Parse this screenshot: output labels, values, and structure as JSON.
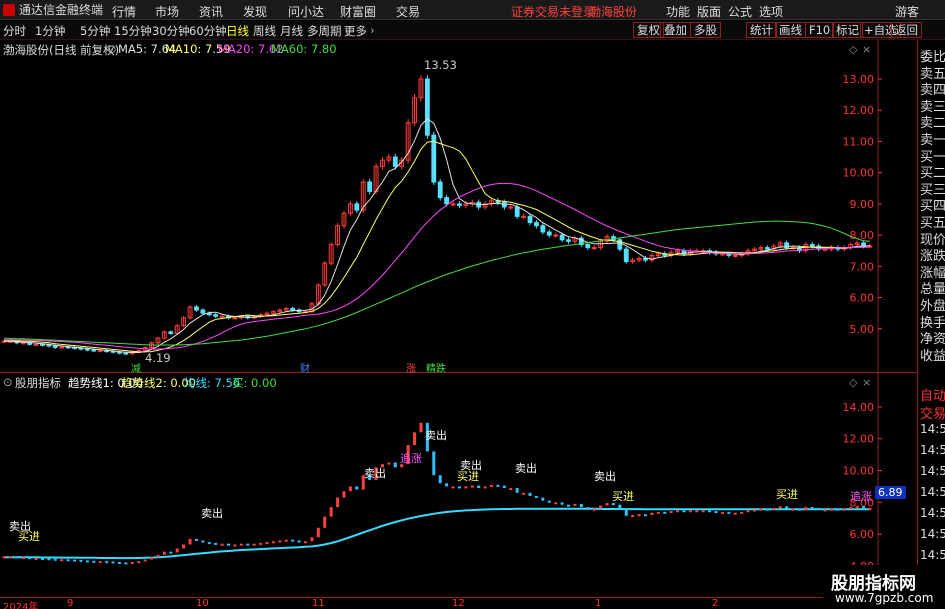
{
  "app": {
    "title": "通达信金融终端",
    "menus": [
      "行情",
      "市场",
      "资讯",
      "发现",
      "问小达",
      "财富圈",
      "交易"
    ],
    "login_notice": "证券交易未登录",
    "stock_link": "渤海股份",
    "right_menus": [
      "功能",
      "版面",
      "公式",
      "选项"
    ],
    "guest": "游客"
  },
  "period_tabs": [
    "分时",
    "1分钟",
    "5分钟",
    "15分钟",
    "30分钟",
    "60分钟",
    "日线",
    "周线",
    "月线",
    "多周期",
    "更多"
  ],
  "active_period": "日线",
  "right_tools": [
    "复权",
    "叠加",
    "多股",
    "统计",
    "画线",
    "F10",
    "标记",
    "+自选",
    "返回"
  ],
  "main_chart": {
    "stock_label": "渤海股份(日线 前复权)",
    "ma_legend": [
      {
        "label": "MA5: 7.64",
        "color": "#e0e0e0"
      },
      {
        "label": "MA10: 7.59",
        "color": "#ffff66"
      },
      {
        "label": "MA20: 7.62",
        "color": "#ff44ff"
      },
      {
        "label": "MA60: 7.80",
        "color": "#44dd44"
      }
    ],
    "high_label": "13.53",
    "low_label": "4.19",
    "markers": [
      {
        "text": "减",
        "color": "#44dd44"
      },
      {
        "text": "财",
        "color": "#4488ff"
      },
      {
        "text": "涨",
        "color": "#ff4444"
      },
      {
        "text": "精跌",
        "color": "#44dd44"
      }
    ]
  },
  "sub_chart": {
    "label": "股朋指标",
    "legend": [
      {
        "label": "趋势线1: 0.00",
        "color": "#ffffff"
      },
      {
        "label": "趋势线2: 0.00",
        "color": "#ffff66"
      },
      {
        "label": "均线: 7.56",
        "color": "#33ddff"
      },
      {
        "label": "买: 0.00",
        "color": "#44dd44"
      }
    ],
    "current_value": "6.89",
    "sell_label": "卖出",
    "buy_label": "买进",
    "up_label": "追涨"
  },
  "right_panel_items": [
    "委比",
    "卖五",
    "卖四",
    "卖三",
    "卖二",
    "卖一",
    "买一",
    "买二",
    "买三",
    "买四",
    "买五",
    "现价",
    "涨跌",
    "涨幅",
    "总量",
    "外盘",
    "换手",
    "净资",
    "收益"
  ],
  "right_panel_lower": [
    "自动",
    "交易"
  ],
  "right_panel_times": [
    "14:5",
    "14:5",
    "14:5",
    "14:5",
    "14:5",
    "14:5",
    "14:5",
    "14:5"
  ],
  "xaxis_labels": [
    "2024年",
    "9",
    "10",
    "11",
    "12",
    "1",
    "2"
  ],
  "watermark": {
    "title": "股朋指标网",
    "url": "www.7gpzb.com"
  },
  "chart_data": [
    {
      "type": "candlestick",
      "title": "渤海股份(日线 前复权)",
      "y_ticks": [
        5.0,
        6.0,
        7.0,
        8.0,
        9.0,
        10.0,
        11.0,
        12.0,
        13.0
      ],
      "ylim": [
        4.0,
        13.8
      ],
      "close": [
        4.6,
        4.6,
        4.55,
        4.55,
        4.5,
        4.5,
        4.48,
        4.45,
        4.4,
        4.42,
        4.4,
        4.38,
        4.35,
        4.32,
        4.3,
        4.3,
        4.28,
        4.25,
        4.22,
        4.2,
        4.25,
        4.3,
        4.4,
        4.55,
        4.7,
        4.9,
        4.85,
        5.1,
        5.35,
        5.7,
        5.6,
        5.5,
        5.45,
        5.4,
        5.4,
        5.35,
        5.35,
        5.4,
        5.35,
        5.4,
        5.45,
        5.5,
        5.55,
        5.6,
        5.65,
        5.6,
        5.55,
        5.55,
        5.8,
        6.4,
        7.1,
        7.7,
        8.3,
        8.7,
        9.0,
        8.8,
        9.7,
        9.4,
        10.2,
        10.4,
        10.5,
        10.2,
        10.4,
        11.6,
        12.4,
        13.0,
        11.2,
        9.7,
        9.2,
        9.0,
        9.0,
        8.95,
        9.0,
        9.05,
        8.9,
        9.0,
        9.1,
        9.05,
        8.9,
        8.9,
        8.6,
        8.6,
        8.4,
        8.3,
        8.1,
        8.0,
        8.0,
        7.85,
        7.8,
        7.9,
        7.7,
        7.6,
        7.6,
        7.8,
        7.95,
        7.85,
        7.55,
        7.15,
        7.2,
        7.25,
        7.2,
        7.35,
        7.4,
        7.35,
        7.45,
        7.5,
        7.4,
        7.5,
        7.5,
        7.5,
        7.45,
        7.4,
        7.4,
        7.35,
        7.35,
        7.4,
        7.5,
        7.55,
        7.6,
        7.55,
        7.65,
        7.75,
        7.6,
        7.6,
        7.5,
        7.7,
        7.65,
        7.55,
        7.55,
        7.6,
        7.55,
        7.6,
        7.7,
        7.75,
        7.65,
        7.65
      ],
      "series": [
        {
          "name": "MA5",
          "values": [
            4.6,
            4.6,
            4.58,
            4.57,
            4.56,
            4.54,
            4.52,
            4.5,
            4.47,
            4.45,
            4.43,
            4.41,
            4.39,
            4.37,
            4.35,
            4.33,
            4.31,
            4.29,
            4.27,
            4.25,
            4.24,
            4.24,
            4.27,
            4.34,
            4.44,
            4.57,
            4.68,
            4.82,
            4.98,
            5.18,
            5.32,
            5.45,
            5.52,
            5.53,
            5.47,
            5.42,
            5.39,
            5.38,
            5.37,
            5.37,
            5.39,
            5.42,
            5.45,
            5.5,
            5.55,
            5.58,
            5.59,
            5.59,
            5.63,
            5.78,
            6.08,
            6.52,
            7.06,
            7.64,
            8.16,
            8.5,
            8.9,
            9.12,
            9.42,
            9.7,
            10.04,
            10.14,
            10.34,
            10.62,
            11.02,
            11.52,
            11.72,
            11.58,
            11.1,
            10.42,
            9.62,
            9.17,
            9.03,
            9.0,
            8.98,
            8.98,
            9.01,
            9.02,
            8.99,
            8.99,
            8.91,
            8.81,
            8.68,
            8.56,
            8.4,
            8.28,
            8.16,
            8.05,
            7.95,
            7.91,
            7.85,
            7.77,
            7.72,
            7.72,
            7.73,
            7.74,
            7.75,
            7.66,
            7.54,
            7.4,
            7.27,
            7.23,
            7.28,
            7.31,
            7.35,
            7.41,
            7.42,
            7.44,
            7.47,
            7.48,
            7.47,
            7.47,
            7.45,
            7.42,
            7.39,
            7.38,
            7.4,
            7.43,
            7.48,
            7.51,
            7.57,
            7.62,
            7.63,
            7.65,
            7.64,
            7.63,
            7.61,
            7.6,
            7.59,
            7.61,
            7.58,
            7.57,
            7.6,
            7.64,
            7.65,
            7.66
          ]
        },
        {
          "name": "MA10",
          "values": [
            4.62,
            4.62,
            4.61,
            4.6,
            4.6,
            4.59,
            4.57,
            4.55,
            4.52,
            4.5,
            4.48,
            4.46,
            4.44,
            4.42,
            4.4,
            4.38,
            4.36,
            4.34,
            4.32,
            4.3,
            4.28,
            4.26,
            4.26,
            4.27,
            4.31,
            4.36,
            4.42,
            4.51,
            4.62,
            4.76,
            4.92,
            5.07,
            5.21,
            5.3,
            5.33,
            5.37,
            5.39,
            5.42,
            5.44,
            5.42,
            5.41,
            5.41,
            5.42,
            5.44,
            5.46,
            5.48,
            5.5,
            5.52,
            5.56,
            5.65,
            5.82,
            6.05,
            6.33,
            6.64,
            6.97,
            7.29,
            7.7,
            8.09,
            8.5,
            8.86,
            9.22,
            9.52,
            9.73,
            10.02,
            10.36,
            10.75,
            10.98,
            11.0,
            10.93,
            10.86,
            10.8,
            10.69,
            10.44,
            10.06,
            9.69,
            9.33,
            9.18,
            9.1,
            9.08,
            9.05,
            9.0,
            8.95,
            8.89,
            8.82,
            8.71,
            8.6,
            8.49,
            8.37,
            8.26,
            8.15,
            8.07,
            7.99,
            7.92,
            7.85,
            7.84,
            7.82,
            7.79,
            7.73,
            7.67,
            7.61,
            7.55,
            7.48,
            7.44,
            7.4,
            7.38,
            7.37,
            7.36,
            7.37,
            7.39,
            7.41,
            7.43,
            7.44,
            7.45,
            7.45,
            7.44,
            7.43,
            7.43,
            7.44,
            7.46,
            7.48,
            7.5,
            7.53,
            7.56,
            7.58,
            7.59,
            7.61,
            7.62,
            7.61,
            7.61,
            7.61,
            7.6,
            7.6,
            7.6,
            7.61,
            7.61,
            7.62
          ]
        },
        {
          "name": "MA20",
          "values": [
            4.65,
            4.65,
            4.64,
            4.64,
            4.63,
            4.63,
            4.62,
            4.61,
            4.6,
            4.59,
            4.58,
            4.57,
            4.55,
            4.53,
            4.51,
            4.49,
            4.47,
            4.45,
            4.43,
            4.41,
            4.39,
            4.37,
            4.36,
            4.35,
            4.35,
            4.36,
            4.37,
            4.39,
            4.42,
            4.47,
            4.53,
            4.6,
            4.68,
            4.77,
            4.87,
            4.98,
            5.07,
            5.15,
            5.2,
            5.23,
            5.26,
            5.28,
            5.31,
            5.33,
            5.35,
            5.37,
            5.4,
            5.43,
            5.45,
            5.47,
            5.51,
            5.56,
            5.63,
            5.72,
            5.83,
            5.96,
            6.12,
            6.3,
            6.5,
            6.72,
            6.95,
            7.19,
            7.43,
            7.68,
            7.94,
            8.2,
            8.42,
            8.62,
            8.8,
            8.96,
            9.1,
            9.22,
            9.32,
            9.41,
            9.5,
            9.57,
            9.62,
            9.65,
            9.66,
            9.65,
            9.62,
            9.57,
            9.5,
            9.42,
            9.32,
            9.22,
            9.12,
            9.02,
            8.92,
            8.82,
            8.71,
            8.6,
            8.49,
            8.39,
            8.29,
            8.2,
            8.12,
            8.04,
            7.96,
            7.88,
            7.8,
            7.73,
            7.66,
            7.61,
            7.57,
            7.54,
            7.51,
            7.49,
            7.47,
            7.45,
            7.43,
            7.42,
            7.41,
            7.4,
            7.4,
            7.4,
            7.4,
            7.41,
            7.42,
            7.43,
            7.45,
            7.47,
            7.49,
            7.5,
            7.52,
            7.53,
            7.55,
            7.56,
            7.57,
            7.58,
            7.59,
            7.59,
            7.6,
            7.61,
            7.62,
            7.62
          ]
        },
        {
          "name": "MA60",
          "values": [
            4.7,
            4.69,
            4.68,
            4.68,
            4.67,
            4.66,
            4.65,
            4.64,
            4.63,
            4.62,
            4.61,
            4.6,
            4.59,
            4.58,
            4.57,
            4.56,
            4.55,
            4.54,
            4.53,
            4.52,
            4.51,
            4.5,
            4.49,
            4.48,
            4.48,
            4.48,
            4.48,
            4.48,
            4.49,
            4.5,
            4.51,
            4.52,
            4.54,
            4.56,
            4.58,
            4.6,
            4.62,
            4.64,
            4.67,
            4.7,
            4.73,
            4.76,
            4.8,
            4.84,
            4.88,
            4.92,
            4.96,
            5.0,
            5.05,
            5.1,
            5.16,
            5.22,
            5.29,
            5.36,
            5.44,
            5.52,
            5.61,
            5.7,
            5.79,
            5.88,
            5.97,
            6.06,
            6.15,
            6.24,
            6.33,
            6.42,
            6.5,
            6.58,
            6.66,
            6.74,
            6.81,
            6.88,
            6.95,
            7.01,
            7.07,
            7.13,
            7.19,
            7.24,
            7.29,
            7.34,
            7.39,
            7.43,
            7.47,
            7.51,
            7.55,
            7.58,
            7.61,
            7.64,
            7.67,
            7.7,
            7.73,
            7.76,
            7.79,
            7.82,
            7.85,
            7.88,
            7.91,
            7.94,
            7.97,
            8.0,
            8.03,
            8.06,
            8.09,
            8.12,
            8.15,
            8.18,
            8.2,
            8.22,
            8.24,
            8.26,
            8.28,
            8.3,
            8.32,
            8.34,
            8.36,
            8.38,
            8.4,
            8.42,
            8.43,
            8.44,
            8.45,
            8.45,
            8.44,
            8.43,
            8.42,
            8.4,
            8.37,
            8.33,
            8.28,
            8.22,
            8.14,
            8.05,
            7.96,
            7.88,
            7.82,
            7.8
          ]
        }
      ]
    },
    {
      "type": "line",
      "title": "股朋指标",
      "y_ticks": [
        4.0,
        6.0,
        8.0,
        10.0,
        12.0,
        14.0
      ],
      "ylim": [
        2.8,
        15.0
      ],
      "series": [
        {
          "name": "均线",
          "values": [
            4.55,
            4.55,
            4.55,
            4.54,
            4.54,
            4.54,
            4.53,
            4.53,
            4.53,
            4.52,
            4.52,
            4.52,
            4.51,
            4.51,
            4.51,
            4.5,
            4.5,
            4.5,
            4.49,
            4.49,
            4.49,
            4.5,
            4.51,
            4.52,
            4.54,
            4.57,
            4.6,
            4.64,
            4.68,
            4.72,
            4.76,
            4.8,
            4.84,
            4.88,
            4.91,
            4.94,
            4.97,
            5.0,
            5.02,
            5.04,
            5.06,
            5.08,
            5.1,
            5.12,
            5.14,
            5.16,
            5.18,
            5.2,
            5.23,
            5.28,
            5.35,
            5.44,
            5.55,
            5.68,
            5.82,
            5.96,
            6.1,
            6.24,
            6.38,
            6.52,
            6.64,
            6.76,
            6.87,
            6.97,
            7.06,
            7.14,
            7.21,
            7.28,
            7.34,
            7.39,
            7.43,
            7.46,
            7.49,
            7.51,
            7.53,
            7.55,
            7.56,
            7.57,
            7.58,
            7.58,
            7.59,
            7.59,
            7.59,
            7.59,
            7.59,
            7.59,
            7.59,
            7.59,
            7.59,
            7.59,
            7.59,
            7.59,
            7.59,
            7.58,
            7.58,
            7.58,
            7.58,
            7.57,
            7.57,
            7.57,
            7.56,
            7.56,
            7.56,
            7.56,
            7.56,
            7.56,
            7.56,
            7.56,
            7.56,
            7.56,
            7.56,
            7.56,
            7.56,
            7.56,
            7.56,
            7.56,
            7.56,
            7.56,
            7.56,
            7.56,
            7.56,
            7.56,
            7.56,
            7.56,
            7.56,
            7.56,
            7.56,
            7.56,
            7.56,
            7.56,
            7.56,
            7.56,
            7.56,
            7.56,
            7.56,
            7.56
          ]
        }
      ]
    }
  ]
}
